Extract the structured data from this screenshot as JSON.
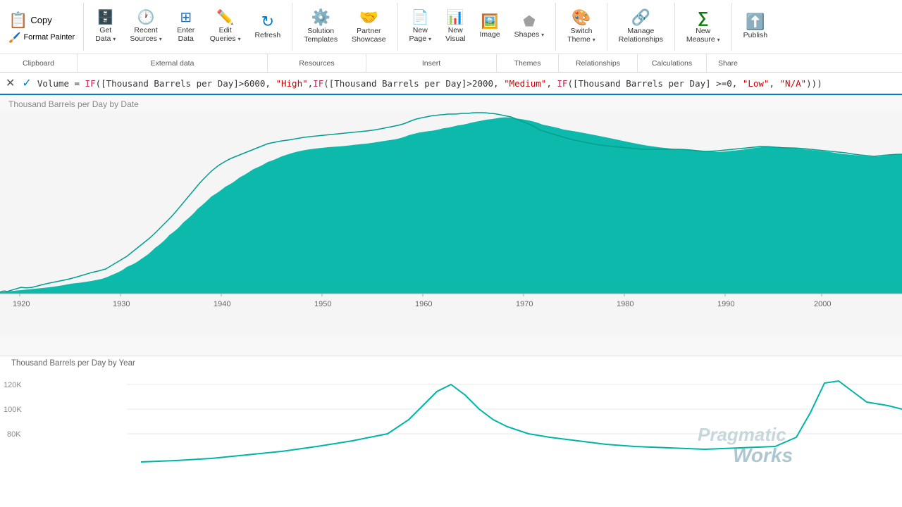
{
  "ribbon": {
    "groups": [
      {
        "name": "clipboard",
        "label": "Clipboard",
        "buttons": [
          {
            "id": "copy",
            "label": "Copy",
            "icon": "📋",
            "type": "big"
          },
          {
            "id": "format-painter",
            "label": "Format Painter",
            "icon": "🖌",
            "type": "small"
          }
        ]
      },
      {
        "name": "external-data",
        "label": "External data",
        "buttons": [
          {
            "id": "get-data",
            "label": "Get\nData",
            "icon": "🗄",
            "dropdown": true
          },
          {
            "id": "recent-sources",
            "label": "Recent\nSources",
            "icon": "🕐",
            "dropdown": true
          },
          {
            "id": "enter-data",
            "label": "Enter\nData",
            "icon": "⊞",
            "dropdown": false
          },
          {
            "id": "edit-queries",
            "label": "Edit\nQueries",
            "icon": "✏",
            "dropdown": true
          },
          {
            "id": "refresh",
            "label": "Refresh",
            "icon": "↻",
            "dropdown": false
          }
        ]
      },
      {
        "name": "resources",
        "label": "Resources",
        "buttons": [
          {
            "id": "solution-templates",
            "label": "Solution\nTemplates",
            "icon": "⚙",
            "dropdown": false
          },
          {
            "id": "partner-showcase",
            "label": "Partner\nShowcase",
            "icon": "🤝",
            "dropdown": false
          }
        ]
      },
      {
        "name": "insert",
        "label": "Insert",
        "buttons": [
          {
            "id": "new-page",
            "label": "New\nPage",
            "icon": "📄",
            "dropdown": true
          },
          {
            "id": "new-visual",
            "label": "New\nVisual",
            "icon": "📊",
            "dropdown": false
          },
          {
            "id": "image",
            "label": "Image",
            "icon": "🖼",
            "dropdown": false
          },
          {
            "id": "shapes",
            "label": "Shapes",
            "icon": "⬟",
            "dropdown": true
          }
        ]
      },
      {
        "name": "themes",
        "label": "Themes",
        "buttons": [
          {
            "id": "switch-theme",
            "label": "Switch\nTheme",
            "icon": "🎨",
            "dropdown": true
          }
        ]
      },
      {
        "name": "relationships",
        "label": "Relationships",
        "buttons": [
          {
            "id": "manage-relationships",
            "label": "Manage\nRelationships",
            "icon": "🔗",
            "dropdown": false
          }
        ]
      },
      {
        "name": "calculations",
        "label": "Calculations",
        "buttons": [
          {
            "id": "new-measure",
            "label": "New\nMeasure",
            "icon": "∑",
            "dropdown": true
          }
        ]
      },
      {
        "name": "share",
        "label": "Share",
        "buttons": [
          {
            "id": "publish",
            "label": "Publish",
            "icon": "⬆",
            "dropdown": false
          }
        ]
      }
    ]
  },
  "formula_bar": {
    "cancel_label": "✕",
    "confirm_label": "✓",
    "formula": "Volume = IF([Thousand Barrels per Day]>6000, \"High\",IF([Thousand Barrels per Day]>2000, \"Medium\", IF([Thousand Barrels per Day] >=0, \"Low\", \"N/A\")))"
  },
  "chart_top": {
    "title": "Thousand Barrels per Day by Date",
    "x_labels": [
      "1920",
      "1930",
      "1940",
      "1950",
      "1960",
      "1970",
      "1980",
      "1990",
      "2000"
    ]
  },
  "chart_bottom": {
    "title": "Thousand Barrels per Day by Year",
    "y_labels": [
      "120K",
      "100K",
      "80K"
    ],
    "watermark_line1": "Pragmatic",
    "watermark_line2": "Works"
  }
}
